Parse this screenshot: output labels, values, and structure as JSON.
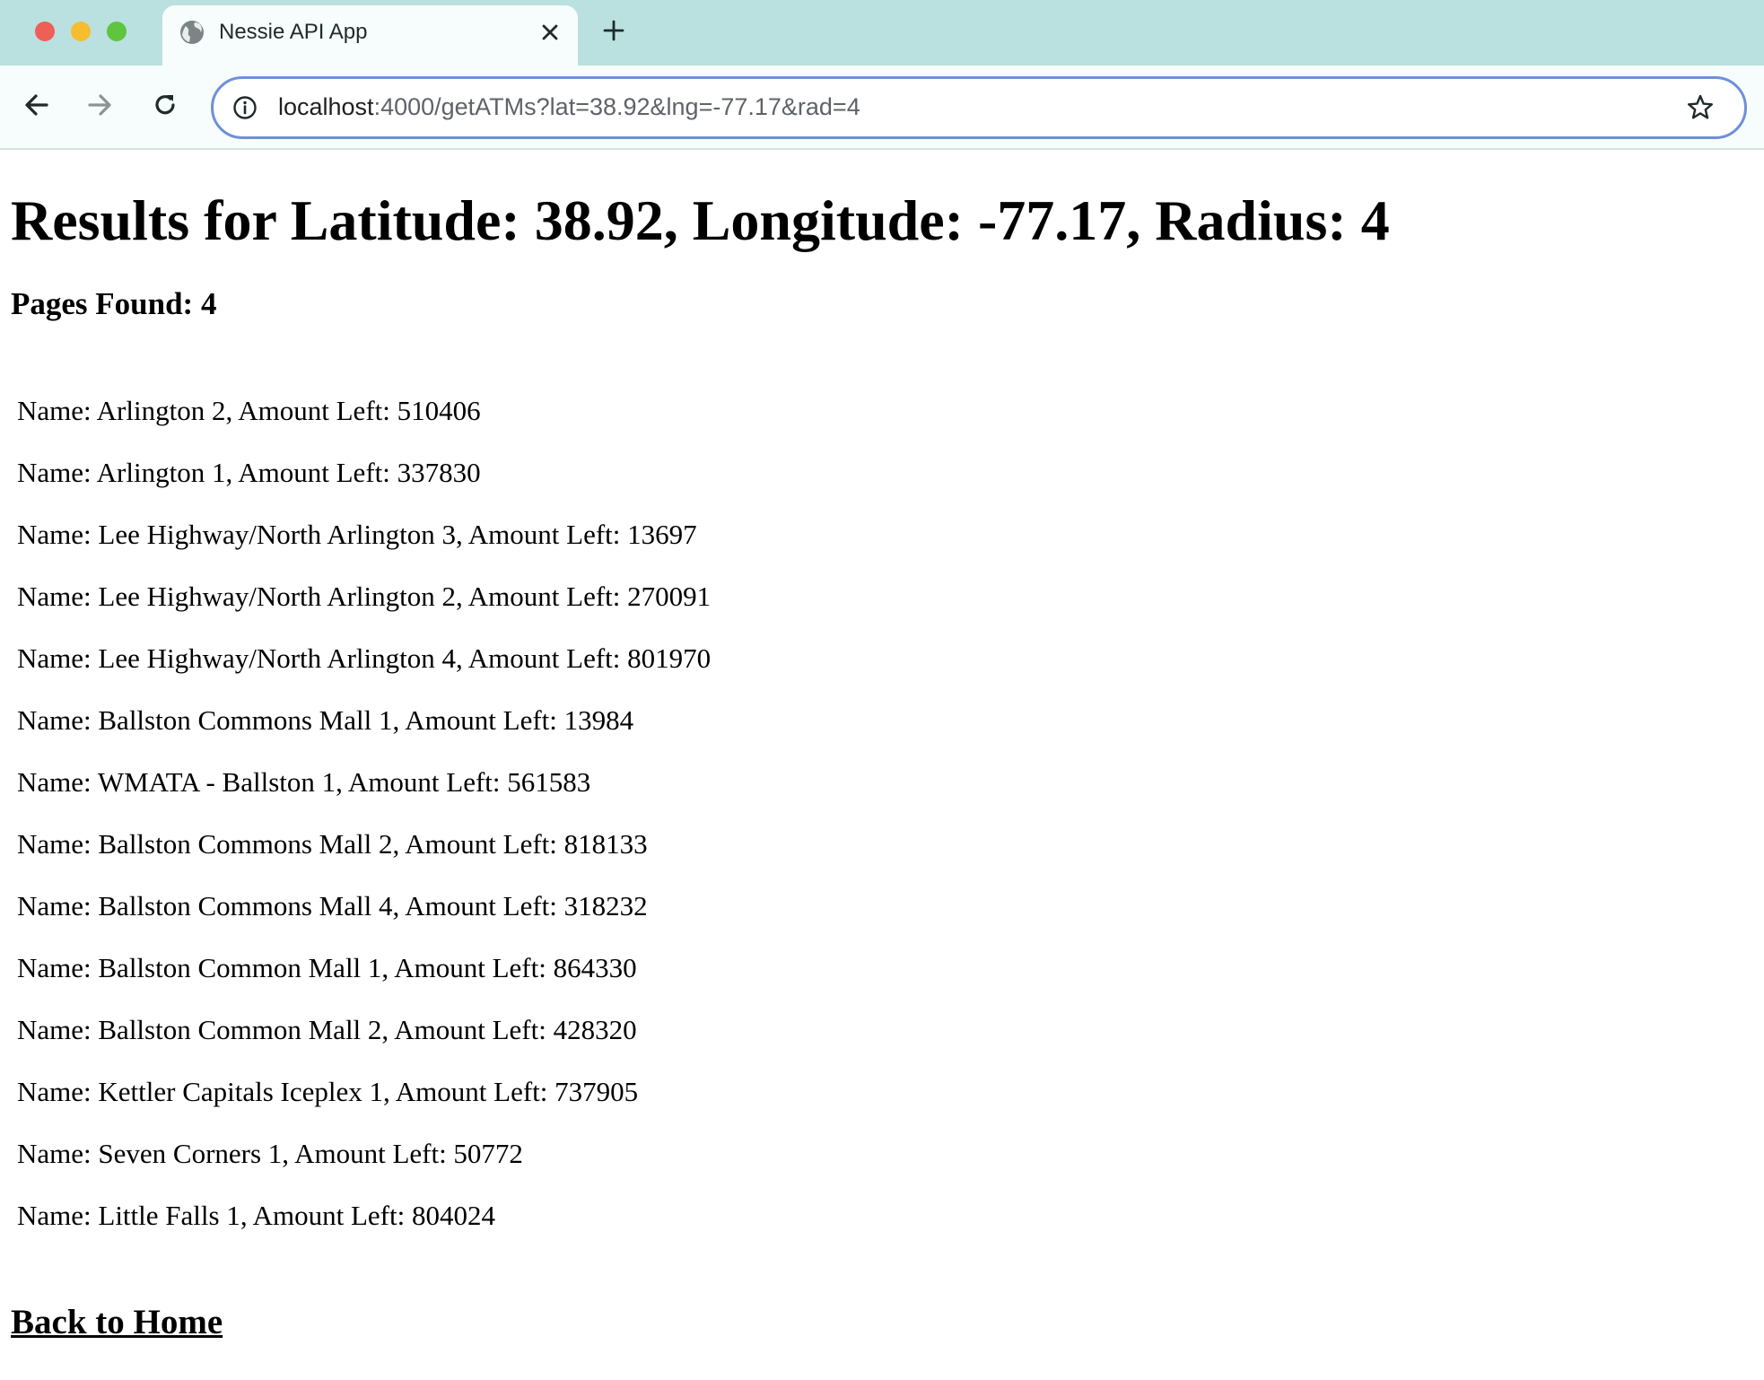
{
  "browser": {
    "tab_title": "Nessie API App",
    "url_host": "localhost",
    "url_rest": ":4000/getATMs?lat=38.92&lng=-77.17&rad=4",
    "icons": {
      "favicon": "globe-icon",
      "close": "close-icon",
      "new_tab": "plus-icon",
      "back": "arrow-left-icon",
      "forward": "arrow-right-icon",
      "reload": "reload-icon",
      "site_info": "info-icon",
      "bookmark": "star-icon"
    },
    "colors": {
      "tabstrip": "#bbe0e0",
      "omnibox_border": "#6f8fd8"
    }
  },
  "page": {
    "heading": "Results for Latitude: 38.92, Longitude: -77.17, Radius: 4",
    "pages_found": "Pages Found: 4",
    "atms": [
      "Name: Arlington 2, Amount Left: 510406",
      "Name: Arlington 1, Amount Left: 337830",
      "Name: Lee Highway/North Arlington 3, Amount Left: 13697",
      "Name: Lee Highway/North Arlington 2, Amount Left: 270091",
      "Name: Lee Highway/North Arlington 4, Amount Left: 801970",
      "Name: Ballston Commons Mall 1, Amount Left: 13984",
      "Name: WMATA - Ballston 1, Amount Left: 561583",
      "Name: Ballston Commons Mall 2, Amount Left: 818133",
      "Name: Ballston Commons Mall 4, Amount Left: 318232",
      "Name: Ballston Common Mall 1, Amount Left: 864330",
      "Name: Ballston Common Mall 2, Amount Left: 428320",
      "Name: Kettler Capitals Iceplex 1, Amount Left: 737905",
      "Name: Seven Corners 1, Amount Left: 50772",
      "Name: Little Falls 1, Amount Left: 804024"
    ],
    "back_link": "Back to Home"
  }
}
